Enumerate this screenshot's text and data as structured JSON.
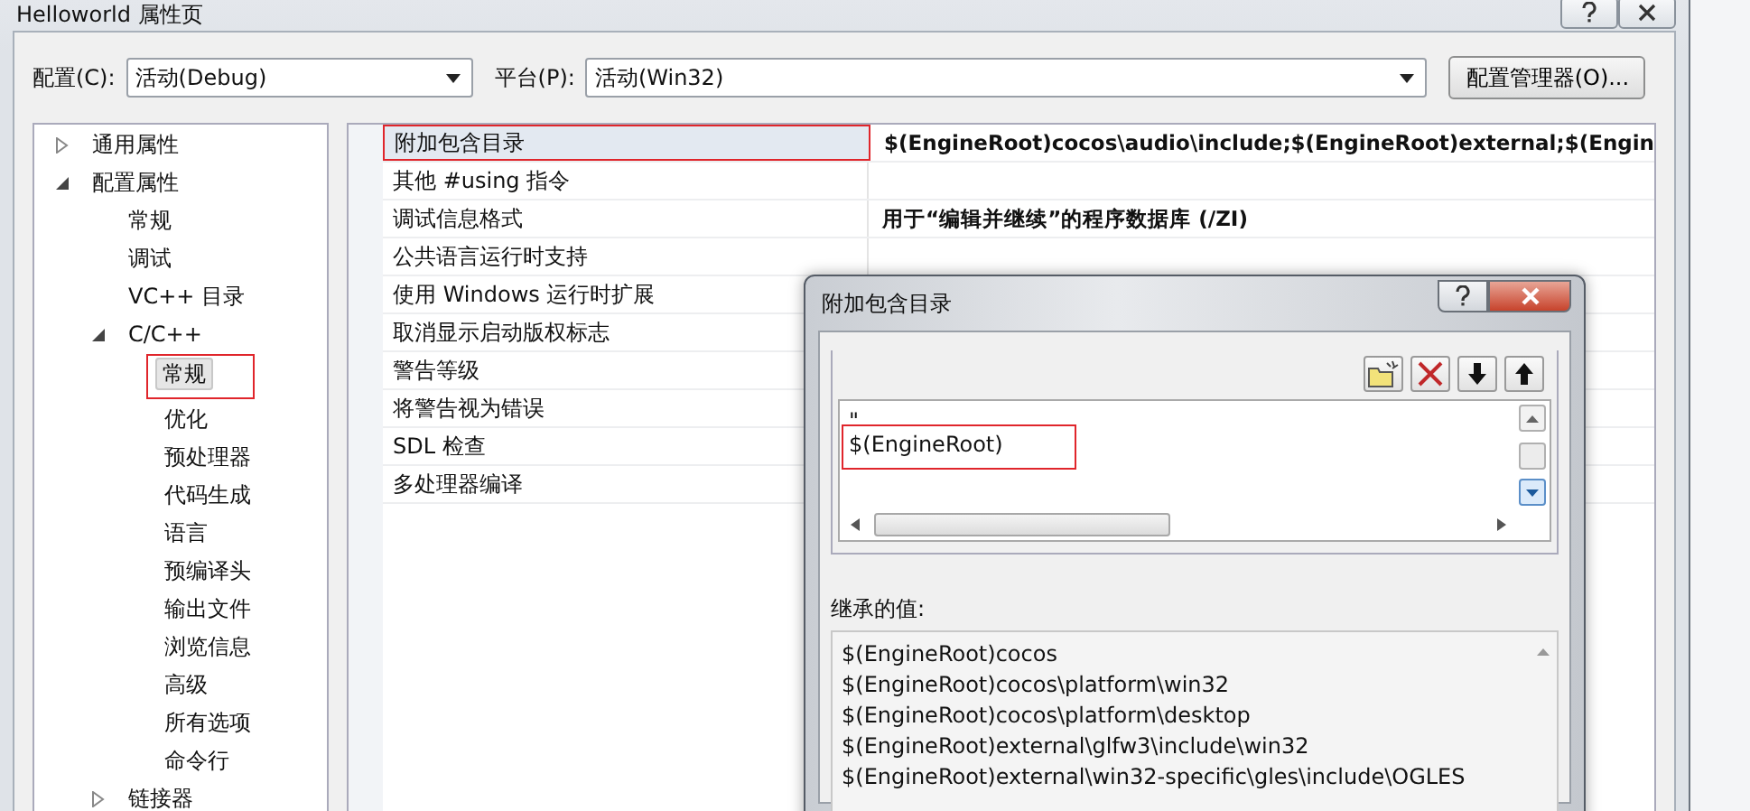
{
  "window": {
    "title": "Helloworld 属性页"
  },
  "config": {
    "label": "配置(C):",
    "value": "活动(Debug)"
  },
  "platform": {
    "label": "平台(P):",
    "value": "活动(Win32)"
  },
  "manager_button": "配置管理器(O)...",
  "tree": [
    {
      "label": "通用属性",
      "expanded": false,
      "selected": false
    },
    {
      "label": "配置属性",
      "expanded": true,
      "selected": false,
      "children": [
        {
          "label": "常规",
          "selected": false
        },
        {
          "label": "调试",
          "selected": false
        },
        {
          "label": "VC++ 目录",
          "selected": false
        },
        {
          "label": "C/C++",
          "expanded": true,
          "selected": false,
          "children": [
            {
              "label": "常规",
              "selected": true,
              "annotated": true
            },
            {
              "label": "优化",
              "selected": false
            },
            {
              "label": "预处理器",
              "selected": false
            },
            {
              "label": "代码生成",
              "selected": false
            },
            {
              "label": "语言",
              "selected": false
            },
            {
              "label": "预编译头",
              "selected": false
            },
            {
              "label": "输出文件",
              "selected": false
            },
            {
              "label": "浏览信息",
              "selected": false
            },
            {
              "label": "高级",
              "selected": false
            },
            {
              "label": "所有选项",
              "selected": false
            },
            {
              "label": "命令行",
              "selected": false
            }
          ]
        },
        {
          "label": "链接器",
          "expanded": false,
          "selected": false
        }
      ]
    }
  ],
  "properties": [
    {
      "name": "附加包含目录",
      "value": "$(EngineRoot)cocos\\audio\\include;$(EngineRoot)external;$(Engin",
      "selected": true,
      "annotated": true
    },
    {
      "name": "其他 #using 指令",
      "selected": false
    },
    {
      "name": "调试信息格式",
      "value": "用于“编辑并继续”的程序数据库 (/ZI)",
      "selected": false
    },
    {
      "name": "公共语言运行时支持",
      "selected": false
    },
    {
      "name": "使用 Windows 运行时扩展",
      "selected": false
    },
    {
      "name": "取消显示启动版权标志",
      "selected": false
    },
    {
      "name": "警告等级",
      "selected": false
    },
    {
      "name": "将警告视为错误",
      "selected": false
    },
    {
      "name": "SDL 检查",
      "selected": false
    },
    {
      "name": "多处理器编译",
      "selected": false
    }
  ],
  "dialog": {
    "title": "附加包含目录",
    "toolbar": [
      {
        "kind": "new-folder"
      },
      {
        "kind": "delete"
      },
      {
        "kind": "down"
      },
      {
        "kind": "up"
      }
    ],
    "entries": [
      {
        "text": "\""
      },
      {
        "text": "$(EngineRoot)",
        "annotated": true
      }
    ],
    "inherited_label": "继承的值:",
    "inherited_values": [
      "$(EngineRoot)cocos",
      "$(EngineRoot)cocos\\platform\\win32",
      "$(EngineRoot)cocos\\platform\\desktop",
      "$(EngineRoot)external\\glfw3\\include\\win32",
      "$(EngineRoot)external\\win32-specific\\gles\\include\\OGLES"
    ]
  }
}
